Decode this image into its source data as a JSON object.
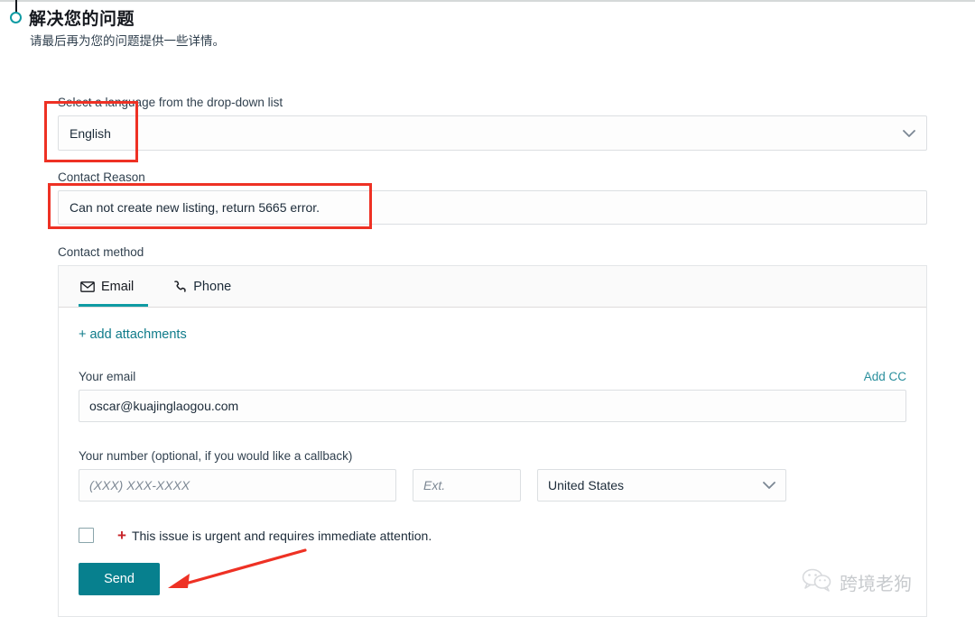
{
  "header": {
    "title": "解决您的问题",
    "subtitle": "请最后再为您的问题提供一些详情。"
  },
  "form": {
    "language": {
      "label": "Select a language from the drop-down list",
      "value": "English",
      "chevron": "chevron-down-icon"
    },
    "contact_reason": {
      "label": "Contact Reason",
      "value": "Can not create new listing, return 5665 error."
    },
    "contact_method": {
      "label": "Contact method",
      "tabs": [
        {
          "label": "Email",
          "icon": "envelope-icon",
          "active": true
        },
        {
          "label": "Phone",
          "icon": "phone-icon",
          "active": false
        }
      ]
    }
  },
  "card": {
    "add_attachments": "+ add attachments",
    "email": {
      "label": "Your email",
      "add_cc": "Add CC",
      "value": "oscar@kuajinglaogou.com"
    },
    "phone": {
      "label": "Your number (optional, if you would like a callback)",
      "number_placeholder": "(XXX) XXX-XXXX",
      "number_value": "",
      "ext_placeholder": "Ext.",
      "ext_value": "",
      "country": "United States"
    },
    "urgent": {
      "checked": false,
      "plus": "+",
      "text": "This issue is urgent and requires immediate attention."
    },
    "send_label": "Send"
  },
  "watermark": {
    "text": "跨境老狗",
    "icon": "wechat-icon"
  },
  "colors": {
    "accent_teal": "#0f9ba3",
    "button_teal": "#07808e",
    "link_teal": "#2a8f9d",
    "annotation_red": "#ee3124",
    "urgent_red": "#c7242a"
  }
}
